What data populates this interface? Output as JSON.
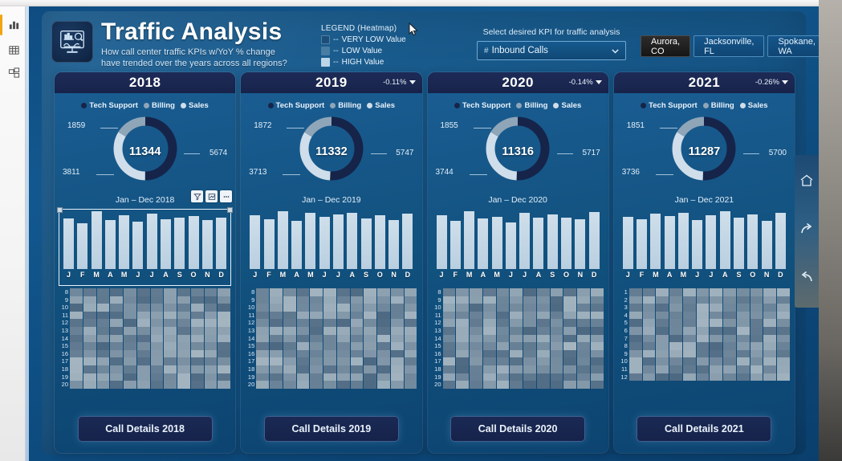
{
  "app": {
    "left_rail": [
      {
        "name": "report-view-icon",
        "label": "Report"
      },
      {
        "name": "data-view-icon",
        "label": "Data"
      },
      {
        "name": "model-view-icon",
        "label": "Model"
      }
    ],
    "right_rail": [
      {
        "name": "home-icon",
        "label": "Home"
      },
      {
        "name": "forward-arrow-icon",
        "label": "Forward"
      },
      {
        "name": "back-arrow-icon",
        "label": "Back"
      }
    ]
  },
  "header": {
    "title": "Traffic Analysis",
    "subtitle_line1": "How call center traffic KPIs w/YoY % change",
    "subtitle_line2": "have trended over the years across all regions?",
    "icon": "dashboard-monitor-icon"
  },
  "legend": {
    "title": "LEGEND (Heatmap)",
    "dash": "--",
    "items": [
      {
        "label": "VERY LOW Value",
        "color": "#1d5party"
      },
      {
        "label": "LOW Value",
        "color": "#7fa6c4"
      },
      {
        "label": "HIGH Value",
        "color": "#b9d3e6"
      }
    ]
  },
  "kpi": {
    "caption": "Select desired KPI for traffic analysis",
    "hash": "#",
    "selected": "Inbound Calls",
    "chevron": "chevron-down-icon"
  },
  "cities": [
    {
      "label": "Aurora, CO",
      "active": true
    },
    {
      "label": "Jacksonville, FL",
      "active": false
    },
    {
      "label": "Spokane, WA",
      "active": false
    }
  ],
  "series_legend": [
    {
      "label": "Tech Support",
      "color": "#16244a"
    },
    {
      "label": "Billing",
      "color": "#8fa5b8"
    },
    {
      "label": "Sales",
      "color": "#cfdeea"
    }
  ],
  "viz_toolbar": [
    {
      "name": "filter-icon",
      "label": "Filters"
    },
    {
      "name": "focus-mode-icon",
      "label": "Focus mode"
    },
    {
      "name": "more-options-icon",
      "label": "More options"
    }
  ],
  "panels": [
    {
      "year": "2018",
      "delta": "",
      "has_delta": false,
      "total": "11344",
      "label_top_left": "1859",
      "label_bottom_left": "3811",
      "label_right": "5674",
      "subtitle": "Jan – Dec 2018",
      "selected": true,
      "button": "Call Details 2018",
      "heat_rows": [
        "8",
        "9",
        "10",
        "11",
        "12",
        "13",
        "14",
        "15",
        "16",
        "17",
        "18",
        "19",
        "20"
      ]
    },
    {
      "year": "2019",
      "delta": "-0.11%",
      "has_delta": true,
      "total": "11332",
      "label_top_left": "1872",
      "label_bottom_left": "3713",
      "label_right": "5747",
      "subtitle": "Jan – Dec 2019",
      "selected": false,
      "button": "Call Details 2019",
      "heat_rows": [
        "8",
        "9",
        "10",
        "11",
        "12",
        "13",
        "14",
        "15",
        "16",
        "17",
        "18",
        "19",
        "20"
      ]
    },
    {
      "year": "2020",
      "delta": "-0.14%",
      "has_delta": true,
      "total": "11316",
      "label_top_left": "1855",
      "label_bottom_left": "3744",
      "label_right": "5717",
      "subtitle": "Jan – Dec 2020",
      "selected": false,
      "button": "Call Details 2020",
      "heat_rows": [
        "8",
        "9",
        "10",
        "11",
        "12",
        "13",
        "14",
        "15",
        "16",
        "17",
        "18",
        "19",
        "20"
      ]
    },
    {
      "year": "2021",
      "delta": "-0.26%",
      "has_delta": true,
      "total": "11287",
      "label_top_left": "1851",
      "label_bottom_left": "3736",
      "label_right": "5700",
      "subtitle": "Jan – Dec 2021",
      "selected": false,
      "button": "Call Details 2021",
      "heat_rows": [
        "1",
        "2",
        "3",
        "4",
        "5",
        "6",
        "7",
        "8",
        "9",
        "10",
        "11",
        "12"
      ]
    }
  ],
  "chart_data": [
    {
      "type": "pie",
      "title": "2018 Inbound Calls by department",
      "labels": [
        "Tech Support",
        "Sales",
        "Billing"
      ],
      "values": [
        5674,
        3811,
        1859
      ],
      "total": 11344,
      "legend_position": "top"
    },
    {
      "type": "pie",
      "title": "2019 Inbound Calls by department",
      "labels": [
        "Tech Support",
        "Sales",
        "Billing"
      ],
      "values": [
        5747,
        3713,
        1872
      ],
      "total": 11332,
      "legend_position": "top"
    },
    {
      "type": "pie",
      "title": "2020 Inbound Calls by department",
      "labels": [
        "Tech Support",
        "Sales",
        "Billing"
      ],
      "values": [
        5717,
        3744,
        1855
      ],
      "total": 11316,
      "legend_position": "top"
    },
    {
      "type": "pie",
      "title": "2021 Inbound Calls by department",
      "labels": [
        "Tech Support",
        "Sales",
        "Billing"
      ],
      "values": [
        5700,
        3736,
        1851
      ],
      "total": 11287,
      "legend_position": "top"
    },
    {
      "type": "bar",
      "title": "Jan – Dec 2018",
      "categories": [
        "J",
        "F",
        "M",
        "A",
        "M",
        "J",
        "J",
        "A",
        "S",
        "O",
        "N",
        "D"
      ],
      "values": [
        84,
        76,
        96,
        82,
        89,
        79,
        92,
        83,
        86,
        88,
        81,
        85
      ],
      "xlabel": "",
      "ylabel": "",
      "grid": false
    },
    {
      "type": "bar",
      "title": "Jan – Dec 2019",
      "categories": [
        "J",
        "F",
        "M",
        "A",
        "M",
        "J",
        "J",
        "A",
        "S",
        "O",
        "N",
        "D"
      ],
      "values": [
        86,
        80,
        93,
        78,
        90,
        84,
        88,
        91,
        82,
        87,
        79,
        89
      ],
      "xlabel": "",
      "ylabel": "",
      "grid": false
    },
    {
      "type": "bar",
      "title": "Jan – Dec 2020",
      "categories": [
        "J",
        "F",
        "M",
        "A",
        "M",
        "J",
        "J",
        "A",
        "S",
        "O",
        "N",
        "D"
      ],
      "values": [
        88,
        79,
        95,
        83,
        86,
        77,
        93,
        85,
        90,
        84,
        82,
        94
      ],
      "xlabel": "",
      "ylabel": "",
      "grid": false
    },
    {
      "type": "bar",
      "title": "Jan – Dec 2021",
      "categories": [
        "J",
        "F",
        "M",
        "A",
        "M",
        "J",
        "J",
        "A",
        "S",
        "O",
        "N",
        "D"
      ],
      "values": [
        85,
        81,
        90,
        86,
        92,
        80,
        87,
        94,
        83,
        89,
        78,
        91
      ],
      "xlabel": "",
      "ylabel": "",
      "grid": false
    },
    {
      "type": "heatmap",
      "title": "2018 hourly traffic heatmap",
      "rows": [
        "8",
        "9",
        "10",
        "11",
        "12",
        "13",
        "14",
        "15",
        "16",
        "17",
        "18",
        "19",
        "20"
      ],
      "columns": [
        "J",
        "F",
        "M",
        "A",
        "M",
        "J",
        "J",
        "A",
        "S",
        "O",
        "N",
        "D"
      ],
      "value_scale": [
        "VERY LOW",
        "LOW",
        "HIGH"
      ]
    },
    {
      "type": "heatmap",
      "title": "2021 monthly traffic heatmap",
      "rows": [
        "1",
        "2",
        "3",
        "4",
        "5",
        "6",
        "7",
        "8",
        "9",
        "10",
        "11",
        "12"
      ],
      "columns": [
        "J",
        "F",
        "M",
        "A",
        "M",
        "J",
        "J",
        "A",
        "S",
        "O",
        "N",
        "D"
      ],
      "value_scale": [
        "VERY LOW",
        "LOW",
        "HIGH"
      ]
    }
  ]
}
